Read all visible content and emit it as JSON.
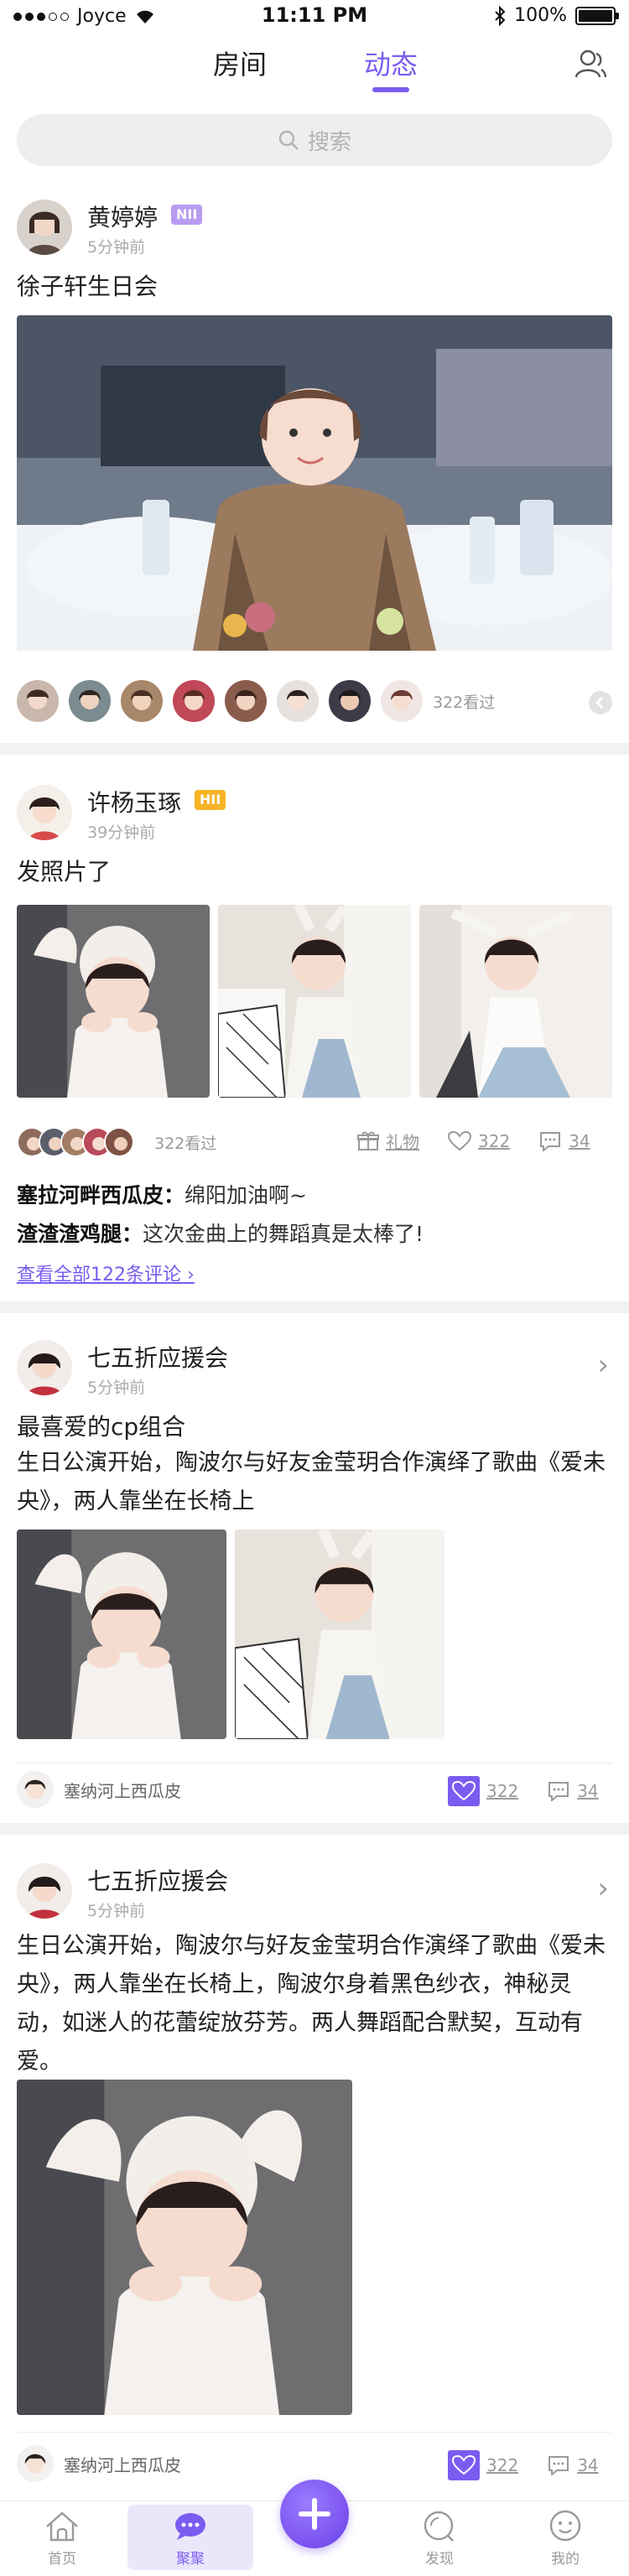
{
  "status_bar": {
    "carrier": "Joyce",
    "time": "11:11 PM",
    "battery": "100%"
  },
  "top_tabs": [
    {
      "label": "房间"
    },
    {
      "label": "动态",
      "active": true
    }
  ],
  "search": {
    "placeholder": "搜索"
  },
  "posts": [
    {
      "username": "黄婷婷",
      "badge": "NII",
      "time": "5分钟前",
      "title": "徐子轩生日会",
      "viewers": "322看过"
    },
    {
      "username": "许杨玉琢",
      "badge": "HII",
      "time": "39分钟前",
      "title": "发照片了",
      "viewers": "322看过",
      "gift_label": "礼物",
      "likes": "322",
      "comments_count": "34",
      "comments": [
        {
          "user": "塞拉河畔西瓜皮",
          "text": "绵阳加油啊~"
        },
        {
          "user": "渣渣渣鸡腿",
          "text": "这次金曲上的舞蹈真是太棒了!"
        }
      ],
      "view_all": "查看全部122条评论"
    },
    {
      "username": "七五折应援会",
      "time": "5分钟前",
      "title": "最喜爱的cp组合",
      "body": "生日公演开始，陶波尔与好友金莹玥合作演绎了歌曲《爱未央》，两人靠坐在长椅上",
      "liker": "塞纳河上西瓜皮",
      "likes": "322",
      "comments_count": "34"
    },
    {
      "username": "七五折应援会",
      "time": "5分钟前",
      "body": "生日公演开始，陶波尔与好友金莹玥合作演绎了歌曲《爱未央》，两人靠坐在长椅上，陶波尔身着黑色纱衣，神秘灵动，如迷人的花蕾绽放芬芳。两人舞蹈配合默契，互动有爱。",
      "liker": "塞纳河上西瓜皮",
      "likes": "322",
      "comments_count": "34"
    }
  ],
  "bottom_nav": [
    {
      "label": "首页"
    },
    {
      "label": "聚聚",
      "active": true
    },
    {
      "label": "发现"
    },
    {
      "label": "我的"
    }
  ],
  "colors": {
    "accent": "#7a5cf0",
    "badge_nii": "#b99cf0",
    "badge_hii": "#f5b325"
  }
}
